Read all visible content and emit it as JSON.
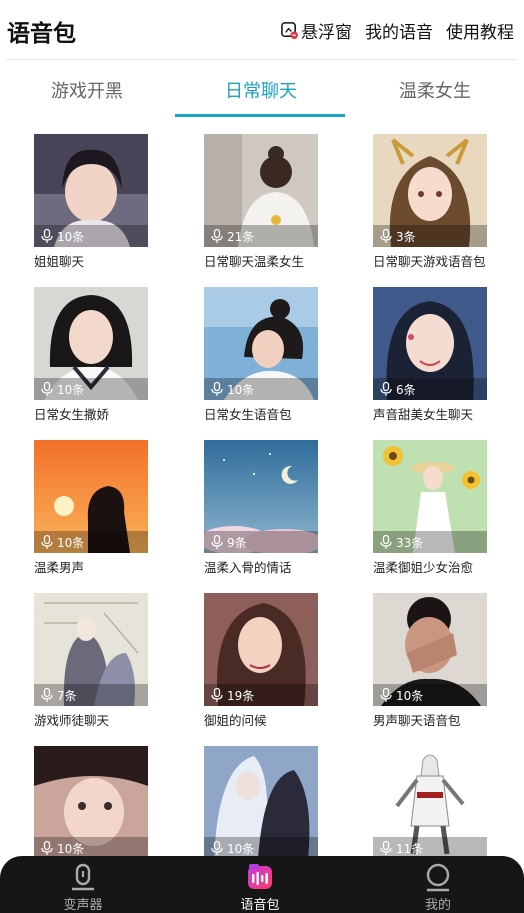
{
  "header": {
    "title": "语音包",
    "float_window": "悬浮窗",
    "my_voice": "我的语音",
    "tutorial": "使用教程"
  },
  "tabs": [
    {
      "label": "游戏开黑",
      "active": false
    },
    {
      "label": "日常聊天",
      "active": true
    },
    {
      "label": "温柔女生",
      "active": false
    }
  ],
  "cards": [
    {
      "name": "姐姐聊天",
      "count": "10条",
      "icon": "portrait-girl"
    },
    {
      "name": "日常聊天温柔女生",
      "count": "21条",
      "icon": "girl-back"
    },
    {
      "name": "日常聊天游戏语音包",
      "count": "3条",
      "icon": "anime-girl"
    },
    {
      "name": "日常女生撒娇",
      "count": "10条",
      "icon": "portrait-girl"
    },
    {
      "name": "日常女生语音包",
      "count": "10条",
      "icon": "portrait-girl"
    },
    {
      "name": "声音甜美女生聊天",
      "count": "6条",
      "icon": "portrait-girl"
    },
    {
      "name": "温柔男声",
      "count": "10条",
      "icon": "sunset-silhouette"
    },
    {
      "name": "温柔入骨的情话",
      "count": "9条",
      "icon": "night-sky"
    },
    {
      "name": "温柔御姐少女治愈",
      "count": "33条",
      "icon": "sunflower-girl"
    },
    {
      "name": "游戏师徒聊天",
      "count": "7条",
      "icon": "anime-sketch"
    },
    {
      "name": "御姐的问候",
      "count": "19条",
      "icon": "anime-girl"
    },
    {
      "name": "男声聊天语音包",
      "count": "10条",
      "icon": "portrait-boy"
    },
    {
      "name": "",
      "count": "10条",
      "icon": "portrait-girl"
    },
    {
      "name": "",
      "count": "10条",
      "icon": "anime-pair"
    },
    {
      "name": "",
      "count": "11条",
      "icon": "assassin-figure"
    }
  ],
  "bottom_nav": [
    {
      "label": "变声器",
      "icon": "microphone-icon",
      "active": false
    },
    {
      "label": "语音包",
      "icon": "voice-pack-icon",
      "active": true
    },
    {
      "label": "我的",
      "icon": "profile-icon",
      "active": false
    }
  ],
  "colors": {
    "accent": "#1aa3c5",
    "nav_bg": "#161616"
  }
}
